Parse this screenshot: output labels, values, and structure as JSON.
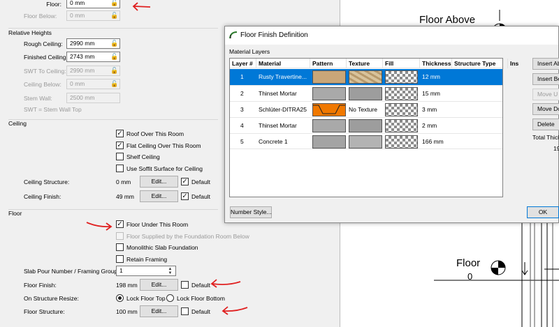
{
  "left_panel": {
    "floor_label": "Floor:",
    "floor_value": "0 mm",
    "floor_below_label": "Floor Below:",
    "floor_below_value": "0 mm",
    "relative_heights_heading": "Relative Heights",
    "rough_ceiling_label": "Rough Ceiling:",
    "rough_ceiling_value": "2990 mm",
    "finished_ceiling_label": "Finished Ceiling:",
    "finished_ceiling_value": "2743 mm",
    "swt_to_ceiling_label": "SWT To Ceiling:",
    "swt_to_ceiling_value": "2990 mm",
    "ceiling_below_label": "Ceiling Below:",
    "ceiling_below_value": "0 mm",
    "stem_wall_label": "Stem Wall:",
    "stem_wall_value": "2500 mm",
    "swt_note": "SWT = Stem Wall Top",
    "ceiling_heading": "Ceiling",
    "roof_over_label": "Roof Over This Room",
    "flat_ceiling_label": "Flat Ceiling Over This Room",
    "shelf_ceiling_label": "Shelf Ceiling",
    "soffit_label": "Use Soffit Surface for Ceiling",
    "ceiling_structure_label": "Ceiling Structure:",
    "ceiling_structure_value": "0 mm",
    "ceiling_finish_label": "Ceiling Finish:",
    "ceiling_finish_value": "49 mm",
    "edit_label": "Edit...",
    "default_label": "Default",
    "floor_heading": "Floor",
    "floor_under_label": "Floor Under This Room",
    "floor_supplied_label": "Floor Supplied by the Foundation Room Below",
    "monolithic_label": "Monolithic Slab Foundation",
    "retain_framing_label": "Retain Framing",
    "slab_pour_label": "Slab Pour Number / Framing Group:",
    "slab_pour_value": "1",
    "floor_finish_label": "Floor Finish:",
    "floor_finish_value": "198 mm",
    "on_resize_label": "On Structure Resize:",
    "lock_top_label": "Lock Floor Top",
    "lock_bottom_label": "Lock Floor Bottom",
    "floor_structure_label": "Floor Structure:",
    "floor_structure_value": "100 mm"
  },
  "drawing": {
    "floor_above_label": "Floor Above",
    "floor_label": "Floor",
    "floor_number": "0"
  },
  "dialog": {
    "title": "Floor Finish Definition",
    "group_label": "Material Layers",
    "columns": [
      "Layer #",
      "Material",
      "Pattern",
      "Texture",
      "Fill",
      "Thickness",
      "Structure Type",
      "Ins"
    ],
    "rows": [
      {
        "layer": "1",
        "material": "Rusty Travertine...",
        "texture": "",
        "thickness": "12 mm"
      },
      {
        "layer": "2",
        "material": "Thinset Mortar",
        "texture": "",
        "thickness": "15 mm"
      },
      {
        "layer": "3",
        "material": "Schlüter-DITRA25",
        "texture": "No Texture",
        "thickness": "3 mm"
      },
      {
        "layer": "4",
        "material": "Thinset Mortar",
        "texture": "",
        "thickness": "2 mm"
      },
      {
        "layer": "5",
        "material": "Concrete 1",
        "texture": "",
        "thickness": "166 mm"
      }
    ],
    "insert_above_label": "Insert Ab",
    "insert_below_label": "Insert Be",
    "move_up_label": "Move U",
    "move_down_label": "Move Do",
    "delete_label": "Delete",
    "total_thickness_label": "Total Thick",
    "total_thickness_value": "19",
    "number_style_label": "Number Style...",
    "ok_label": "OK"
  },
  "colors": {
    "selection": "#0078d7",
    "annotation_red": "#e02020",
    "ditra_orange": "#f07800"
  }
}
